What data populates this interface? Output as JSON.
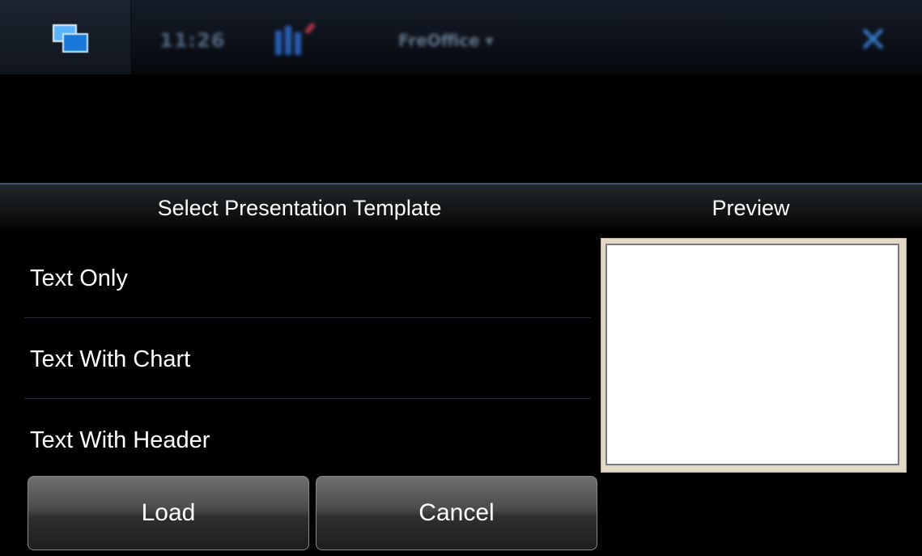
{
  "statusbar": {
    "clock": "11:26",
    "app_name": "FreOffice"
  },
  "dialog": {
    "title": "Select Presentation Template",
    "preview_label": "Preview",
    "templates": [
      {
        "label": "Text Only"
      },
      {
        "label": "Text With Chart"
      },
      {
        "label": "Text With Header"
      }
    ],
    "buttons": {
      "load": "Load",
      "cancel": "Cancel"
    }
  },
  "icons": {
    "task_switcher": "task-switcher-icon",
    "signal": "signal-icon",
    "close": "close-icon"
  },
  "colors": {
    "accent": "#3c88e0",
    "divider": "#1d2a38"
  }
}
